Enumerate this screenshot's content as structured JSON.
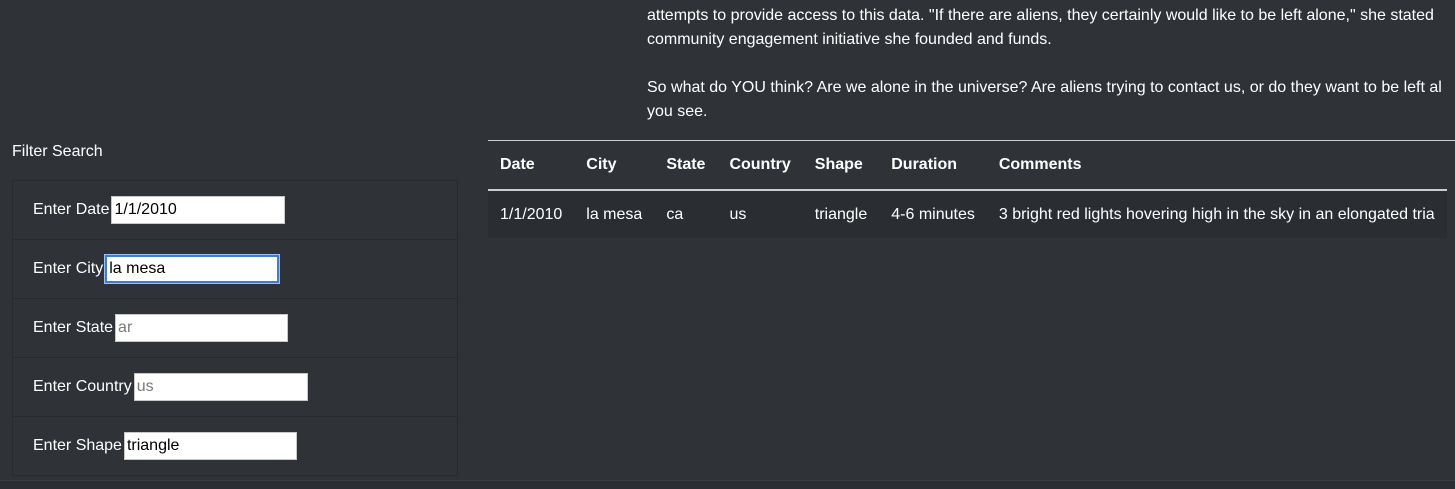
{
  "article": {
    "line1": "attempts to provide access to this data. \"If there are aliens, they certainly would like to be left alone,\" she stated",
    "line2": "community engagement initiative she founded and funds.",
    "line3": "So what do YOU think? Are we alone in the universe? Are aliens trying to contact us, or do they want to be left al",
    "line4": "you see."
  },
  "filter": {
    "title": "Filter Search",
    "fields": [
      {
        "label": "Enter Date",
        "value": "1/1/2010",
        "placeholder": ""
      },
      {
        "label": "Enter City",
        "value": "la mesa",
        "placeholder": ""
      },
      {
        "label": "Enter State",
        "value": "",
        "placeholder": "ar"
      },
      {
        "label": "Enter Country",
        "value": "",
        "placeholder": "us"
      },
      {
        "label": "Enter Shape",
        "value": "triangle",
        "placeholder": ""
      }
    ]
  },
  "table": {
    "headers": [
      "Date",
      "City",
      "State",
      "Country",
      "Shape",
      "Duration",
      "Comments"
    ],
    "rows": [
      [
        "1/1/2010",
        "la mesa",
        "ca",
        "us",
        "triangle",
        "4-6 minutes",
        "3 bright red lights hovering high in the sky in an elongated tria"
      ]
    ]
  }
}
